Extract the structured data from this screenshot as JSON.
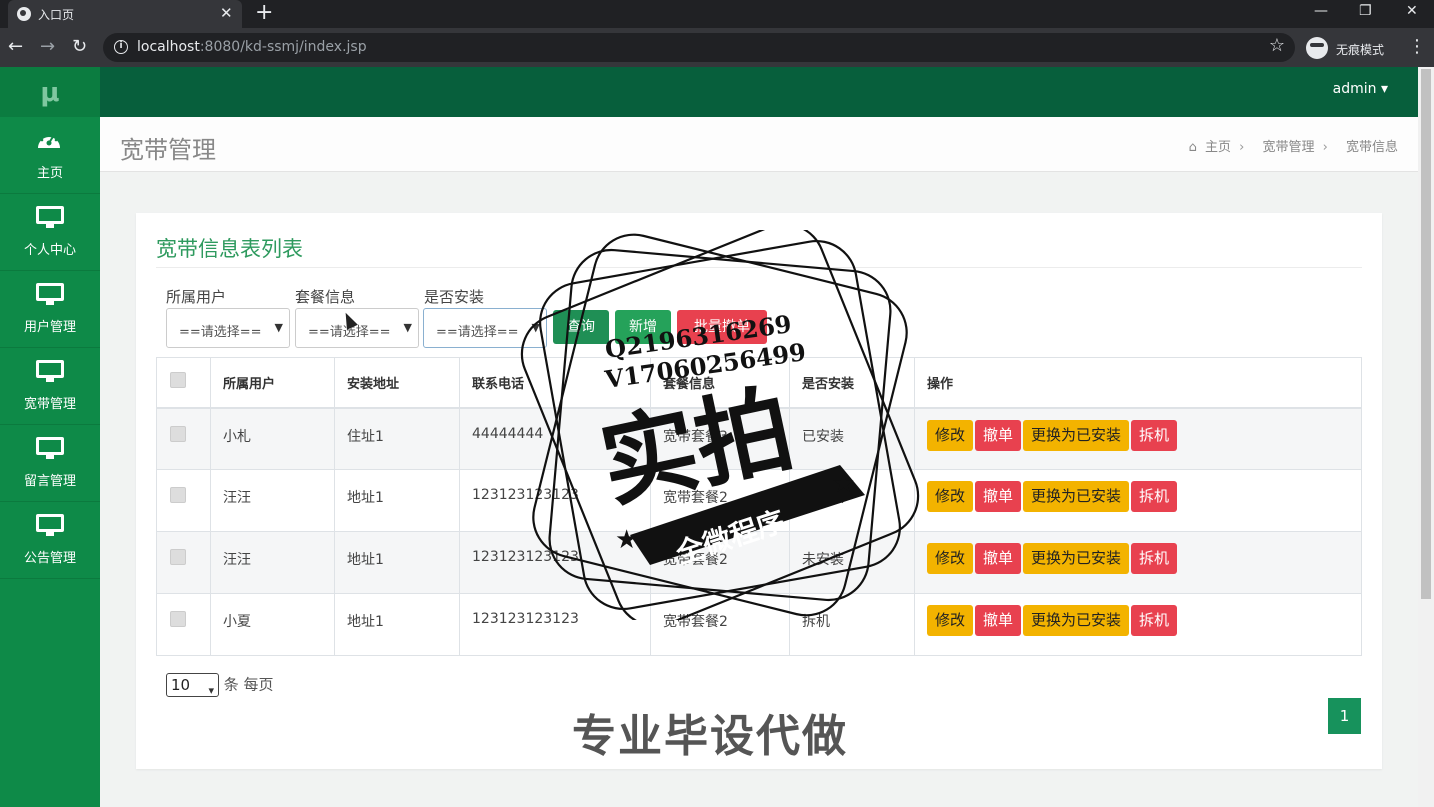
{
  "browser": {
    "tab_title": "入口页",
    "tab_close": "✕",
    "new_tab": "+",
    "url_host": "localhost",
    "url_rest": ":8080/kd-ssmj/index.jsp",
    "incognito_label": "无痕模式",
    "minimize": "—",
    "restore": "❐",
    "close": "✕"
  },
  "sidebar": {
    "logo": "μ",
    "items": [
      {
        "label": "主页",
        "icon": "dashboard-icon"
      },
      {
        "label": "个人中心",
        "icon": "monitor-icon"
      },
      {
        "label": "用户管理",
        "icon": "monitor-icon"
      },
      {
        "label": "宽带管理",
        "icon": "monitor-icon"
      },
      {
        "label": "留言管理",
        "icon": "monitor-icon"
      },
      {
        "label": "公告管理",
        "icon": "monitor-icon"
      }
    ]
  },
  "topbar": {
    "user": "admin ▾"
  },
  "page": {
    "title": "宽带管理",
    "breadcrumb": [
      "主页",
      "宽带管理",
      "宽带信息"
    ]
  },
  "card": {
    "title": "宽带信息表列表",
    "filters": [
      {
        "label": "所属用户",
        "value": "==请选择=="
      },
      {
        "label": "套餐信息",
        "value": "==请选择=="
      },
      {
        "label": "是否安装",
        "value": "==请选择=="
      }
    ],
    "buttons": {
      "query": "查询",
      "add": "新增",
      "batch_delete": "批量撤单"
    },
    "table": {
      "headers": [
        "所属用户",
        "安装地址",
        "联系电话",
        "套餐信息",
        "是否安装",
        "操作"
      ],
      "rows": [
        [
          "小札",
          "住址1",
          "44444444",
          "宽带套餐3",
          "已安装"
        ],
        [
          "汪汪",
          "地址1",
          "123123123123",
          "宽带套餐2",
          "未安装"
        ],
        [
          "汪汪",
          "地址1",
          "123123123123",
          "宽带套餐2",
          "未安装"
        ],
        [
          "小夏",
          "地址1",
          "123123123123",
          "宽带套餐2",
          "拆机"
        ]
      ],
      "actions": [
        "修改",
        "撤单",
        "更换为已安装",
        "拆机"
      ]
    },
    "page_size": {
      "value": "10",
      "suffix": "条 每页"
    },
    "current_page": "1"
  },
  "watermark": {
    "qq": "Q2196316269",
    "vx": "V17060256499",
    "main": "实拍",
    "banner": "全微程序",
    "bottom": "专业毕设代做"
  },
  "colors": {
    "sidebar": "#0e8a48",
    "topbar": "#075f3c",
    "accent": "#2e9a5e",
    "warning": "#f3b300",
    "danger": "#e8414f"
  }
}
